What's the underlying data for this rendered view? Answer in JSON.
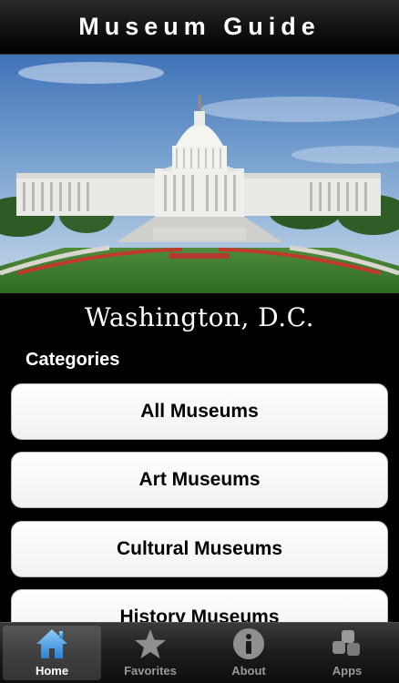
{
  "header": {
    "title": "Museum Guide"
  },
  "hero": {
    "image": "us-capitol-building"
  },
  "city": {
    "name": "Washington, D.C."
  },
  "categories": {
    "label": "Categories",
    "items": [
      {
        "label": "All Museums"
      },
      {
        "label": "Art Museums"
      },
      {
        "label": "Cultural Museums"
      },
      {
        "label": "History Museums"
      }
    ]
  },
  "tabbar": {
    "active": "Home",
    "tabs": [
      {
        "label": "Home",
        "icon": "house-icon"
      },
      {
        "label": "Favorites",
        "icon": "star-icon"
      },
      {
        "label": "About",
        "icon": "info-icon"
      },
      {
        "label": "Apps",
        "icon": "apps-icon"
      }
    ]
  },
  "colors": {
    "active_icon": "#4a9ee8",
    "inactive_icon": "#9a9a9a",
    "button_bg": "#ffffff"
  }
}
